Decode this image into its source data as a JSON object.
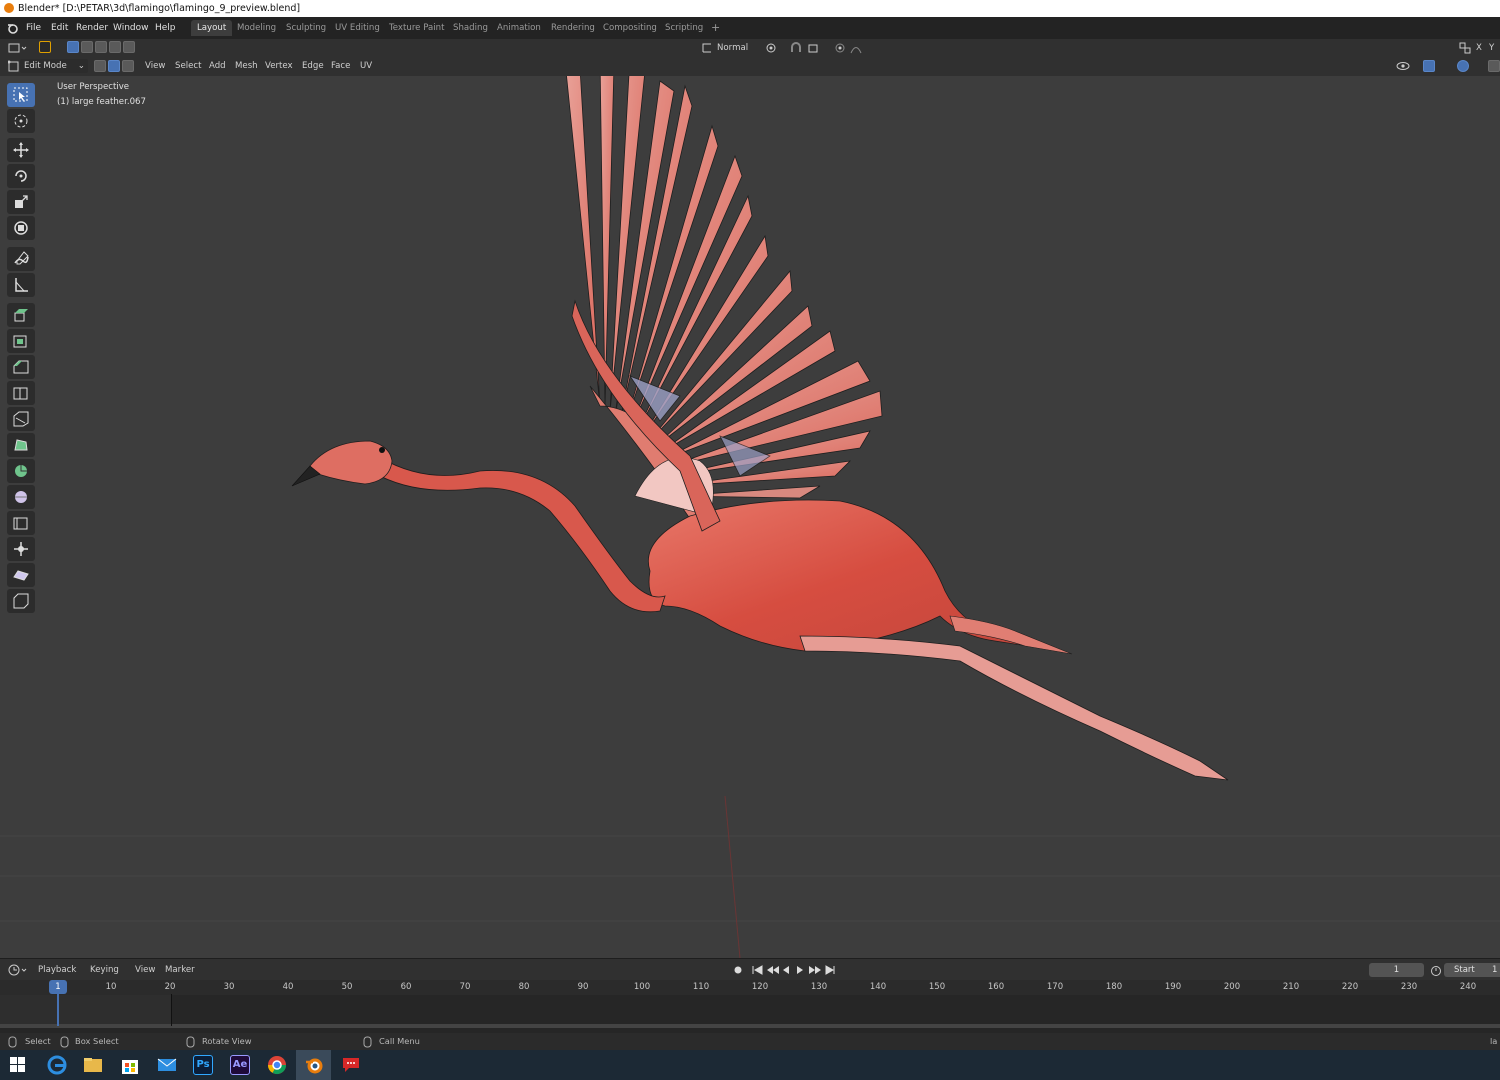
{
  "titlebar": {
    "title": "Blender* [D:\\PETAR\\3d\\flamingo\\flamingo_9_preview.blend]"
  },
  "menubar": {
    "items": [
      "File",
      "Edit",
      "Render",
      "Window",
      "Help"
    ],
    "workspaces": [
      "Layout",
      "Modeling",
      "Sculpting",
      "UV Editing",
      "Texture Paint",
      "Shading",
      "Animation",
      "Rendering",
      "Compositing",
      "Scripting"
    ],
    "active_workspace": "Layout",
    "add_tab": "+"
  },
  "header1": {
    "orientation": "Normal",
    "right_axes": [
      "X",
      "Y"
    ]
  },
  "header2": {
    "mode": "Edit Mode",
    "menus": [
      "View",
      "Select",
      "Add",
      "Mesh",
      "Vertex",
      "Edge",
      "Face",
      "UV"
    ]
  },
  "viewport": {
    "perspective": "User Perspective",
    "object": "(1) large feather.067",
    "colors": {
      "background": "#3d3d3d",
      "flamingo": "#d9574b",
      "wire": "#1a1a1a",
      "accent": "#4772b3"
    }
  },
  "toolbar": {
    "tools": [
      "select-box-icon",
      "cursor-icon",
      "move-icon",
      "rotate-icon",
      "scale-icon",
      "transform-icon",
      "annotate-icon",
      "measure-icon",
      "extrude-icon",
      "inset-icon",
      "bevel-icon",
      "loop-cut-icon",
      "knife-icon",
      "poly-build-icon",
      "spin-icon",
      "smooth-icon",
      "edge-slide-icon",
      "shrink-fatten-icon",
      "shear-icon",
      "rip-icon"
    ]
  },
  "timeline": {
    "menus": [
      "Playback",
      "Keying",
      "View",
      "Marker"
    ],
    "current_frame": "1",
    "frame_field": "1",
    "start_label": "Start",
    "start_value": "1",
    "ticks": [
      "10",
      "20",
      "30",
      "40",
      "50",
      "60",
      "70",
      "80",
      "90",
      "100",
      "110",
      "120",
      "130",
      "140",
      "150",
      "160",
      "170",
      "180",
      "190",
      "200",
      "210",
      "220",
      "230",
      "240"
    ]
  },
  "statusbar": {
    "select": "Select",
    "box_select": "Box Select",
    "rotate_view": "Rotate View",
    "call_menu": "Call Menu",
    "right_text": "la"
  },
  "taskbar": {
    "apps": [
      "windows-start-icon",
      "edge-icon",
      "file-explorer-icon",
      "store-icon",
      "mail-icon",
      "photoshop-icon",
      "after-effects-icon",
      "chrome-icon",
      "blender-icon",
      "chat-icon"
    ],
    "ps_label": "Ps",
    "ae_label": "Ae"
  }
}
